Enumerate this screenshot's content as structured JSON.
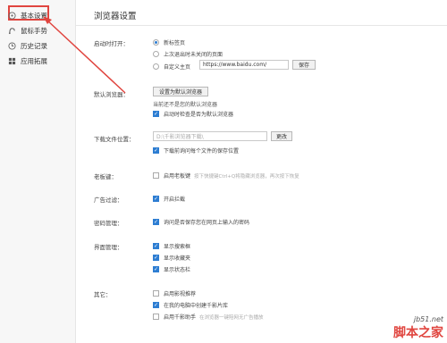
{
  "sidebar": {
    "items": [
      {
        "label": "基本设置",
        "icon": "circle-settings-icon"
      },
      {
        "label": "鼠标手势",
        "icon": "mouse-gesture-icon"
      },
      {
        "label": "历史记录",
        "icon": "clock-icon"
      },
      {
        "label": "应用拓展",
        "icon": "apps-grid-icon"
      }
    ]
  },
  "main": {
    "title": "浏览器设置",
    "startup": {
      "label": "启动时打开：",
      "options": [
        "新标签页",
        "上次退出时未关闭的页面",
        "自定义主页"
      ],
      "homepage_value": "https://www.baidu.com/",
      "save_label": "保存"
    },
    "default_browser": {
      "label": "默认浏览器：",
      "button_label": "设置为默认浏览器",
      "status_text": "当前还不是您的默认浏览器",
      "check_label": "启动时检查是否为默认浏览器"
    },
    "download": {
      "label": "下载文件位置：",
      "path_value": "D:\\千影浏览器下载\\",
      "change_label": "更改",
      "check_label": "下载前询问每个文件的保存位置"
    },
    "boss_key": {
      "label": "老板键：",
      "check_label": "启用老板键",
      "hint": "按下快捷键Ctrl+Q将隐藏浏览器，再次按下恢复"
    },
    "adblock": {
      "label": "广告过滤：",
      "check_label": "开启拦截"
    },
    "password": {
      "label": "密码管理：",
      "check_label": "询问是否保存您在网页上输入的密码"
    },
    "interface": {
      "label": "界面管理：",
      "options": [
        "显示搜索框",
        "显示收藏夹",
        "显示状态栏"
      ]
    },
    "other": {
      "label": "其它：",
      "options": [
        "启用影视推荐",
        "在我的电脑中创建千影片库",
        "启用千影助手"
      ],
      "hint": "在浏览器一键陪网无广告播放"
    }
  },
  "watermark": {
    "url": "jb51.net",
    "brand": "脚本之家"
  },
  "colors": {
    "accent": "#2d7dd2",
    "annotation": "#e0453f"
  }
}
